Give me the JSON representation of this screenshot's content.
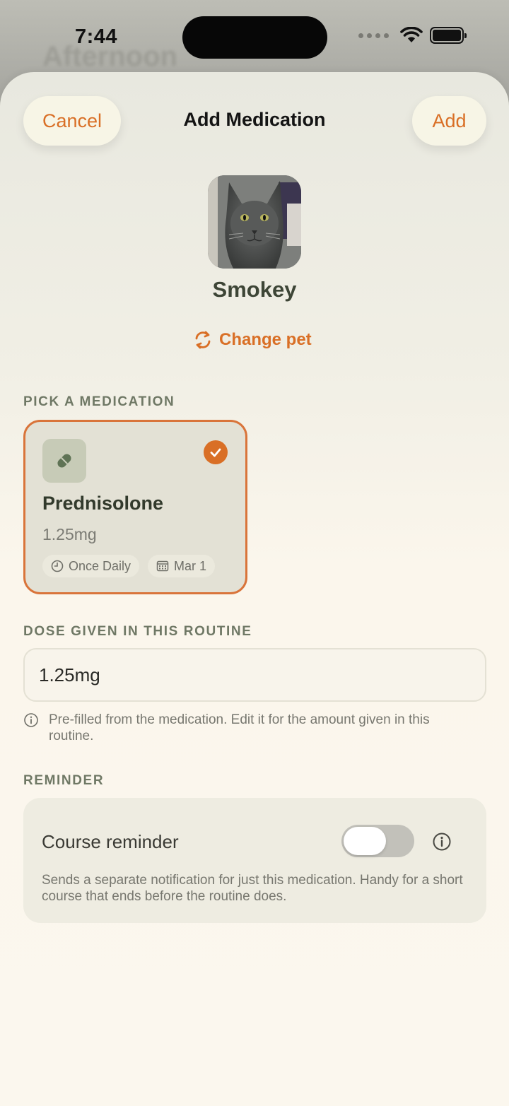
{
  "status_bar": {
    "time": "7:44",
    "icons": [
      "cellular-dots-icon",
      "wifi-icon",
      "battery-icon"
    ]
  },
  "background_view": {
    "title": "Afternoon"
  },
  "header": {
    "cancel_label": "Cancel",
    "title": "Add Medication",
    "add_label": "Add"
  },
  "pet": {
    "name": "Smokey",
    "change_label": "Change pet"
  },
  "medication_section": {
    "label": "PICK A MEDICATION",
    "card": {
      "name": "Prednisolone",
      "dose": "1.25mg",
      "frequency": "Once Daily",
      "start_date": "Mar 1",
      "selected": true
    }
  },
  "dose_section": {
    "label": "DOSE GIVEN IN THIS ROUTINE",
    "value": "1.25mg",
    "hint": "Pre-filled from the medication. Edit it for the amount given in this routine."
  },
  "reminder_section": {
    "label": "REMINDER",
    "title": "Course reminder",
    "enabled": false,
    "description": "Sends a separate notification for just this medication. Handy for a short course that ends before the routine does."
  },
  "colors": {
    "accent": "#d96f26",
    "section_label": "#6f7865",
    "sheet_bg": "#fbf7ee"
  }
}
